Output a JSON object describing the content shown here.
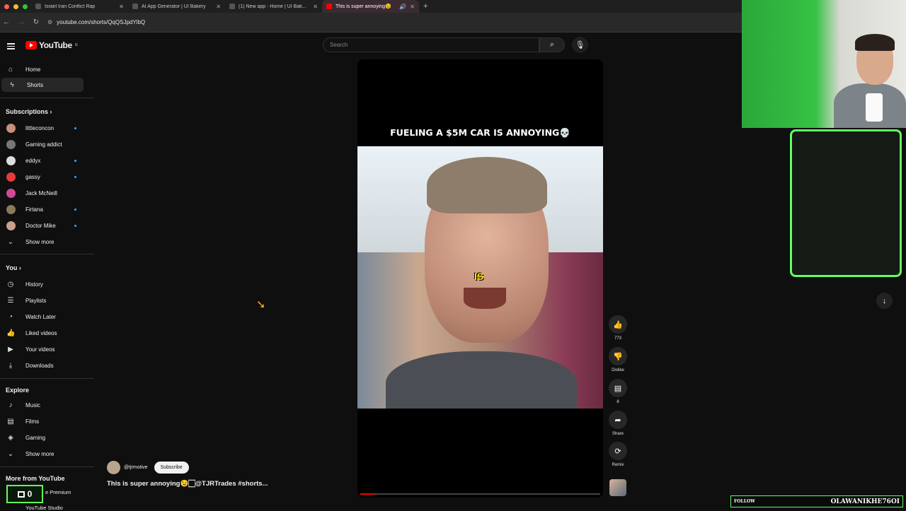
{
  "browser": {
    "tabs": [
      {
        "title": "Israel Iran Conflict Rap"
      },
      {
        "title": "AI App Generator | UI Bakery"
      },
      {
        "title": "(1) New app - Home | UI Bak..."
      },
      {
        "title": "This is super annoying😉"
      }
    ],
    "url": "youtube.com/shorts/QqQSJpdYlbQ"
  },
  "youtube": {
    "logo_text": "YouTube",
    "logo_sup": "IE"
  },
  "search": {
    "placeholder": "Search"
  },
  "sidebar": {
    "main": [
      {
        "label": "Home",
        "icon": "home-icon"
      },
      {
        "label": "Shorts",
        "icon": "shorts-icon"
      }
    ],
    "subscriptions_header": "Subscriptions",
    "subscriptions": [
      {
        "label": "littleconcon",
        "color": "#c98f7a",
        "dot": true
      },
      {
        "label": "Gaming addict",
        "color": "#777777",
        "dot": false
      },
      {
        "label": "eddyx",
        "color": "#dddddd",
        "dot": true
      },
      {
        "label": "gassy",
        "color": "#e83a3a",
        "dot": true
      },
      {
        "label": "Jack McNeill",
        "color": "#d04a9a",
        "dot": false
      },
      {
        "label": "Firtana",
        "color": "#8a7a5a",
        "dot": true
      },
      {
        "label": "Doctor Mike",
        "color": "#c9a08a",
        "dot": true
      }
    ],
    "show_more": "Show more",
    "you_header": "You",
    "you": [
      {
        "label": "History"
      },
      {
        "label": "Playlists"
      },
      {
        "label": "Watch Later"
      },
      {
        "label": "Liked videos"
      },
      {
        "label": "Your videos"
      },
      {
        "label": "Downloads"
      }
    ],
    "explore_header": "Explore",
    "explore": [
      {
        "label": "Music"
      },
      {
        "label": "Films"
      },
      {
        "label": "Gaming"
      }
    ],
    "show_more_2": "Show more",
    "more_header": "More from YouTube",
    "premium": "e Premium",
    "studio": "YouTube Studio"
  },
  "short": {
    "caption": "FUELING A $5M CAR IS ANNOYING💀",
    "overlay_word": "IS",
    "progress": 0.06,
    "channel": "@tjrmotive",
    "subscribe": "Subscribe",
    "title": "This is super annoying😉🏻@TJRTrades #shorts..."
  },
  "actions": {
    "likes": "773",
    "dislike": "Dislike",
    "comments": "8",
    "share": "Share",
    "remix": "Remix"
  },
  "overlay": {
    "follow_label": "FOLLOW",
    "follow_name": "OLAWANIKHE76OI",
    "counter": "0"
  }
}
